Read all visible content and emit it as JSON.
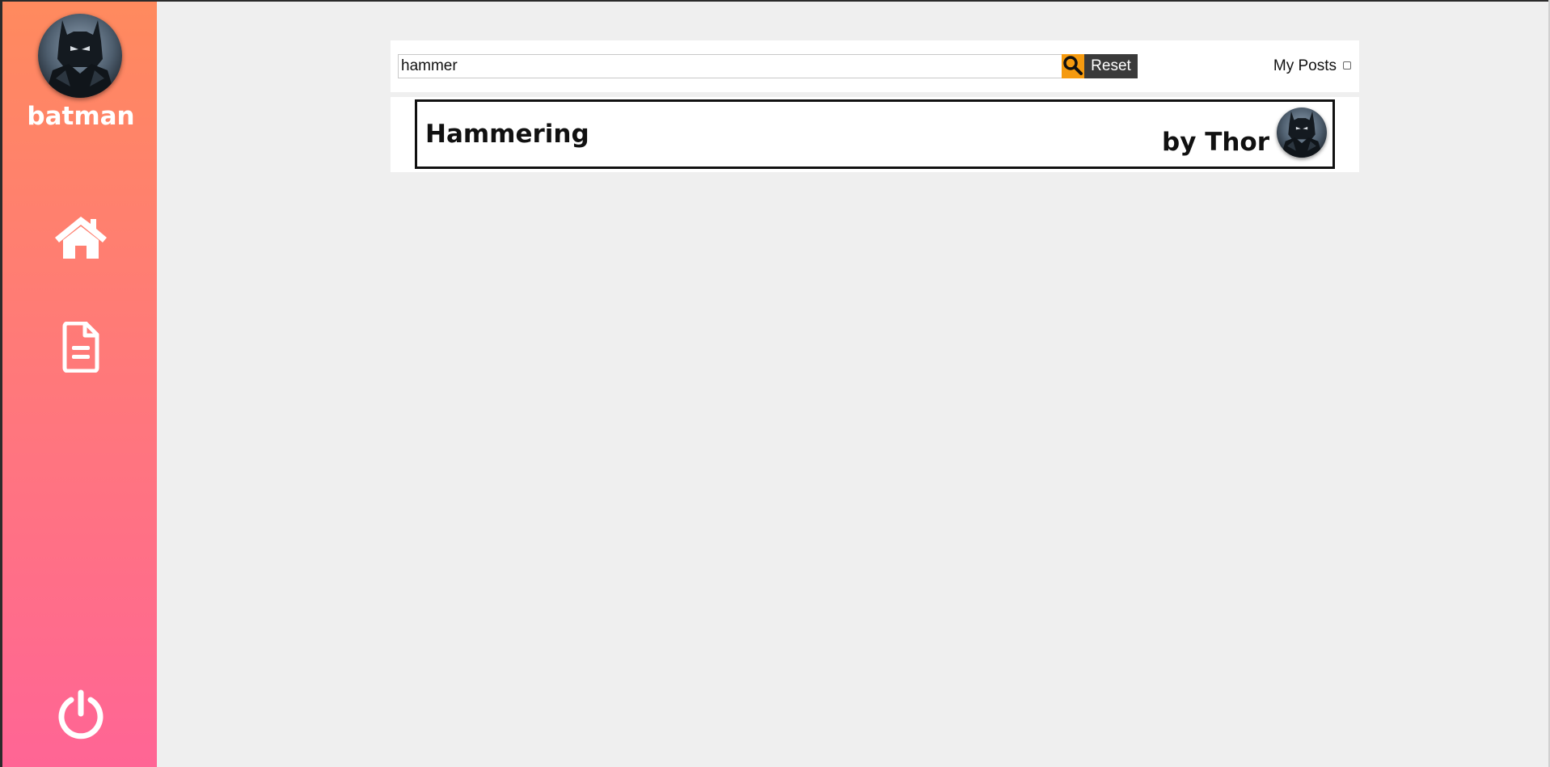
{
  "sidebar": {
    "username": "batman",
    "nav": [
      {
        "icon": "home-icon"
      },
      {
        "icon": "document-icon"
      },
      {
        "icon": "power-icon"
      }
    ],
    "icon_color": "#ffffff",
    "gradient_top": "#ff8a5e",
    "gradient_bottom": "#ff6595"
  },
  "search": {
    "value": "hammer",
    "search_icon": "search-icon",
    "reset_label": "Reset",
    "my_posts_label": "My Posts",
    "my_posts_checked": false,
    "accent": "#f59a0f"
  },
  "results": [
    {
      "title": "Hammering",
      "author": "by Thor"
    }
  ]
}
